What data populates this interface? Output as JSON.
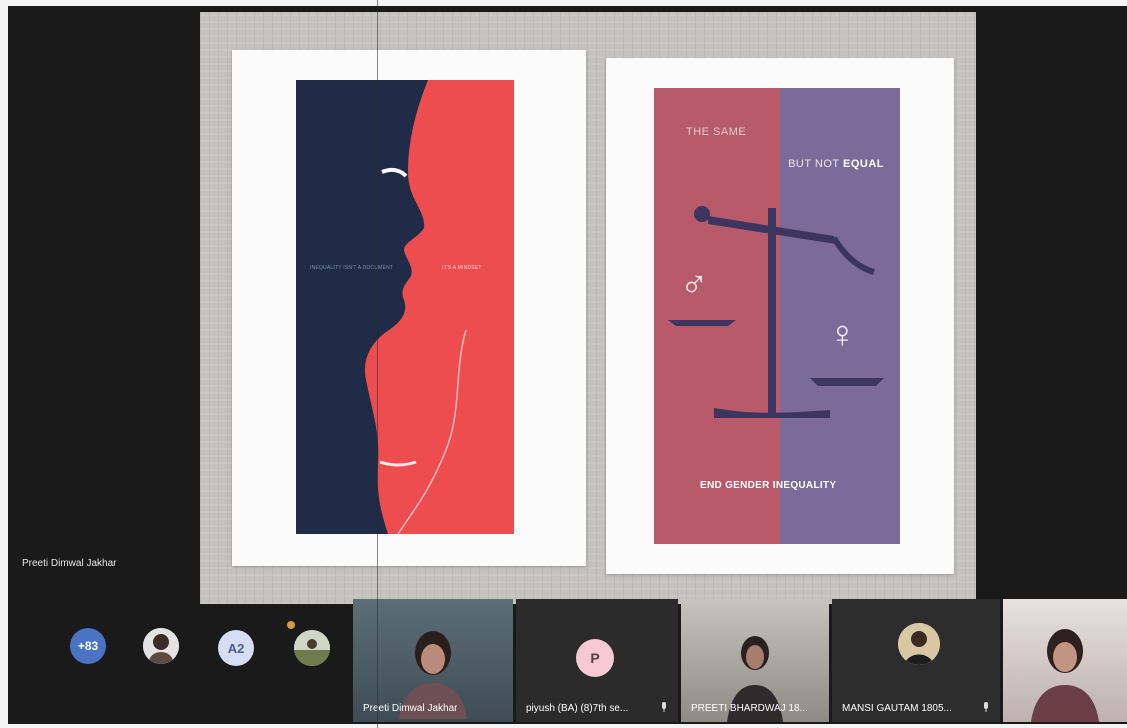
{
  "presentation": {
    "left_poster": {
      "caption_left": "INEQUALITY ISN'T A DOCUMENT",
      "caption_right": "IT'S A MINDSET"
    },
    "right_poster": {
      "label_same": "THE SAME",
      "label_not_prefix": "BUT NOT ",
      "label_equal": "EQUAL",
      "slogan": "END GENDER INEQUALITY",
      "male_symbol": "♂",
      "female_symbol": "♀"
    }
  },
  "presenter_label": "Preeti Dimwal Jakhar",
  "participants_strip": {
    "overflow_count": "+83",
    "initials_bubble": "A2",
    "tiles": [
      {
        "name": "Preeti Dimwal Jakhar"
      },
      {
        "name": "piyush (BA) (8)7th se...",
        "initial": "P"
      },
      {
        "name": "PREETI BHARDWAJ 18..."
      },
      {
        "name": "MANSI GAUTAM 1805..."
      },
      {
        "name": ""
      }
    ]
  },
  "colors": {
    "navy": "#1f2b47",
    "coral": "#ee4d4f",
    "rose": "#b75a6a",
    "lavender": "#7b6a9a"
  }
}
